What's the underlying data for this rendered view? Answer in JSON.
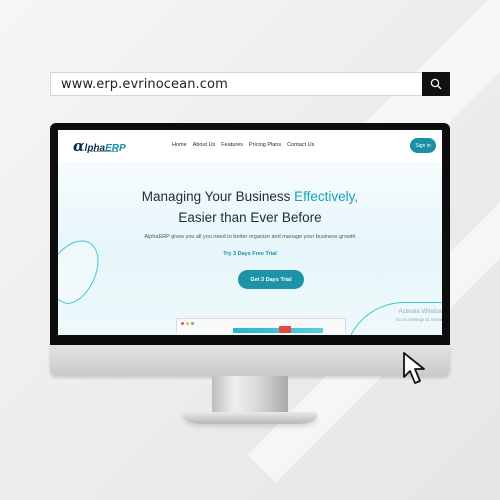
{
  "search": {
    "url": "www.erp.evrinocean.com",
    "button_icon": "search-icon"
  },
  "site": {
    "logo": {
      "alpha": "α",
      "rest": "lpha",
      "erp": "ERP"
    },
    "nav": [
      "Home",
      "About Us",
      "Features",
      "Pricing Plans",
      "Contact Us"
    ],
    "signin_label": "Sign in",
    "hero": {
      "title_line1_start": "Managing Your Business ",
      "title_line1_accent": "Effectively,",
      "title_line2": "Easier than Ever Before",
      "subtitle": "AlphaERP gives you all you need to better organize and manage your business growth",
      "trial_text": "Try 3 Days Free Trial",
      "cta_label": "Get 3 Days Trial"
    },
    "watermark": {
      "line1": "Activate Windows",
      "line2": "Go to Settings to activate"
    }
  },
  "colors": {
    "accent": "#17a3ba",
    "button": "#1c93a6",
    "nav_text": "#1a2a3a"
  },
  "icons": {
    "cursor": "mouse-pointer-icon"
  }
}
